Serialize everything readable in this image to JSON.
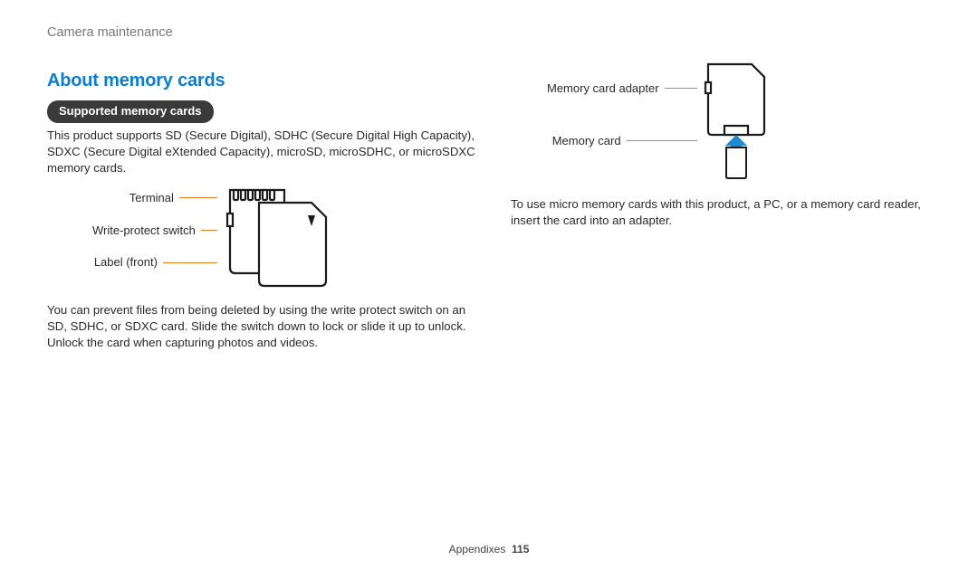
{
  "header": "Camera maintenance",
  "section_title": "About memory cards",
  "pill": "Supported memory cards",
  "left": {
    "intro": "This product supports SD (Secure Digital), SDHC (Secure Digital High Capacity), SDXC (Secure Digital eXtended Capacity), microSD, microSDHC, or microSDXC memory cards.",
    "labels": {
      "terminal": "Terminal",
      "write_protect": "Write-protect switch",
      "label_front": "Label (front)"
    },
    "write_protect_text": "You can prevent files from being deleted by using the write protect switch on an SD, SDHC, or SDXC card. Slide the switch down to lock or slide it up to unlock. Unlock the card when capturing photos and videos."
  },
  "right": {
    "labels": {
      "adapter": "Memory card adapter",
      "card": "Memory card"
    },
    "adapter_text": "To use micro memory cards with this product, a PC, or a memory card reader, insert the card into an adapter."
  },
  "footer": {
    "section": "Appendixes",
    "page": "115"
  }
}
